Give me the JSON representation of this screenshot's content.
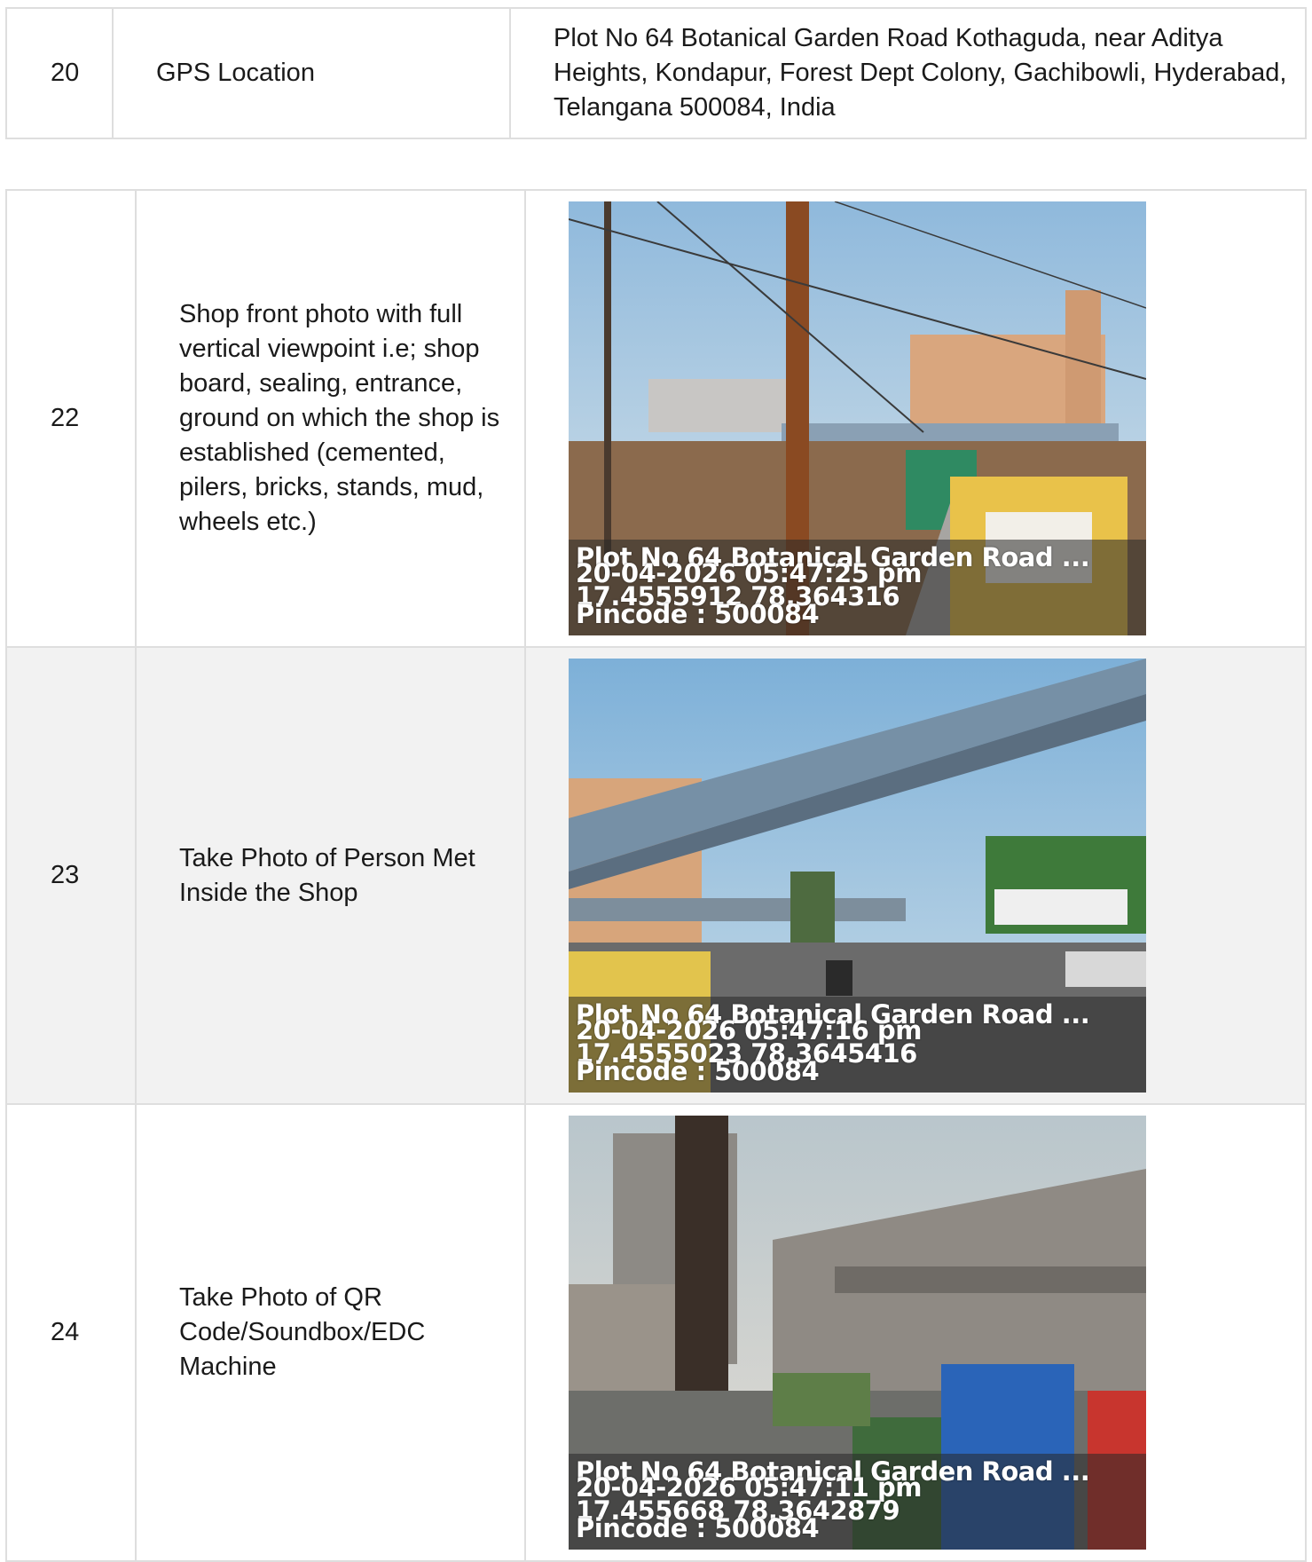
{
  "gps_row": {
    "number": "20",
    "label": "GPS Location",
    "value": "Plot No 64 Botanical Garden Road Kothaguda, near Aditya Heights, Kondapur, Forest Dept Colony, Gachibowli, Hyderabad, Telangana 500084, India"
  },
  "photo_rows": [
    {
      "number": "22",
      "label": "Shop front photo with full vertical viewpoint i.e; shop board, sealing, entrance, ground on which the shop is established (cemented, pilers, bricks, stands, mud, wheels etc.)",
      "stamp": {
        "address": "Plot No 64 Botanical Garden Road ...",
        "datetime": "20-04-2026 05:47:25 pm",
        "coords": "17.4555912 78.364316",
        "pincode": "Pincode : 500084"
      }
    },
    {
      "number": "23",
      "label": "Take Photo of Person Met Inside the Shop",
      "stamp": {
        "address": "Plot No 64 Botanical Garden Road ...",
        "datetime": "20-04-2026 05:47:16 pm",
        "coords": "17.4555023 78.3645416",
        "pincode": "Pincode : 500084"
      }
    },
    {
      "number": "24",
      "label": "Take Photo of QR Code/Soundbox/EDC Machine",
      "stamp": {
        "address": "Plot No 64 Botanical Garden Road ...",
        "datetime": "20-04-2026 05:47:11 pm",
        "coords": "17.455668 78.3642879",
        "pincode": "Pincode : 500084"
      }
    }
  ]
}
